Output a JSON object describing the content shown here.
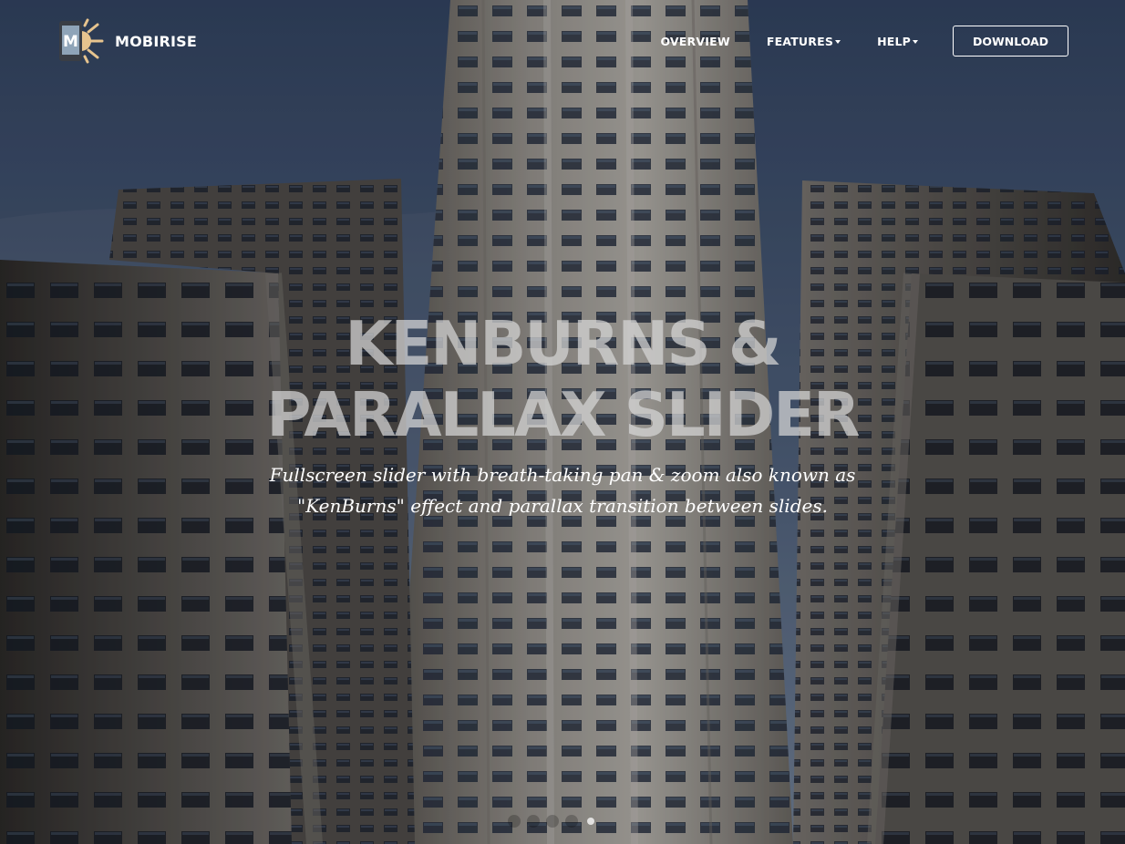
{
  "brand": {
    "name": "MOBIRISE",
    "logo_letter": "M",
    "logo_icon": "mobile-sun-icon"
  },
  "nav": {
    "overview": "OVERVIEW",
    "features": "FEATURES",
    "help": "HELP",
    "download": "DOWNLOAD"
  },
  "hero": {
    "title_line1": "KENBURNS &",
    "title_line2": "PARALLAX SLIDER",
    "subtitle_line1": "Fullscreen slider with breath-taking pan & zoom also known as",
    "subtitle_line2": "\"KenBurns\" effect and parallax transition between slides.",
    "background_icon": "skyscraper-photo"
  },
  "slider": {
    "slides": 5,
    "active_slide": 5
  },
  "colors": {
    "nav_text": "#ffffff",
    "title_text": "#d7d7d7",
    "subtitle_text": "#ffffff",
    "button_border": "#ffffff",
    "sky": "#5f7393",
    "building": "#5c5a58"
  }
}
